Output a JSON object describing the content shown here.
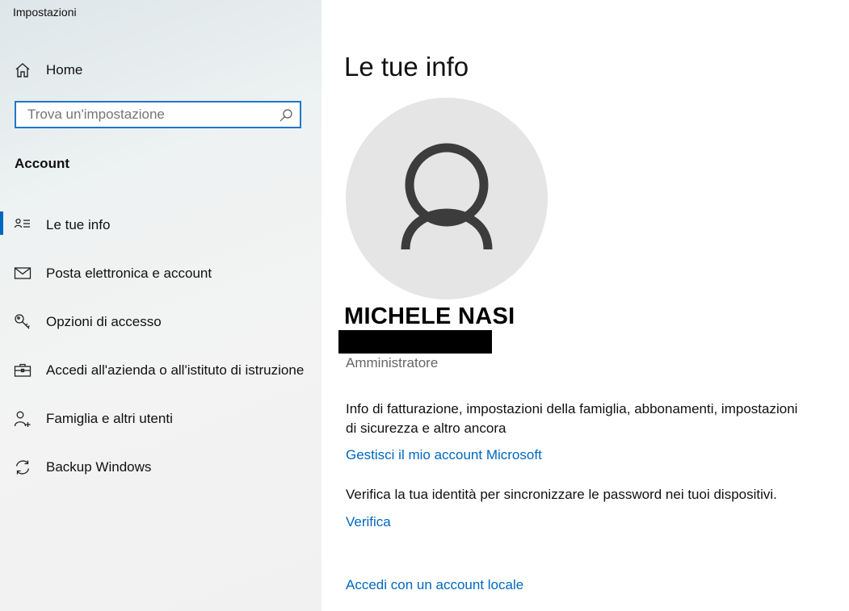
{
  "app": {
    "title": "Impostazioni"
  },
  "sidebar": {
    "home_label": "Home",
    "search": {
      "placeholder": "Trova un'impostazione",
      "value": ""
    },
    "section_title": "Account",
    "items": [
      {
        "label": "Le tue info",
        "icon": "user-card-icon",
        "active": true
      },
      {
        "label": "Posta elettronica e account",
        "icon": "mail-icon",
        "active": false
      },
      {
        "label": "Opzioni di accesso",
        "icon": "key-icon",
        "active": false
      },
      {
        "label": "Accedi all'azienda o all'istituto di istruzione",
        "icon": "briefcase-icon",
        "active": false
      },
      {
        "label": "Famiglia e altri utenti",
        "icon": "add-person-icon",
        "active": false
      },
      {
        "label": "Backup Windows",
        "icon": "sync-icon",
        "active": false
      }
    ]
  },
  "main": {
    "title": "Le tue info",
    "user": {
      "name": "MICHELE NASI",
      "role": "Amministratore"
    },
    "billing_info": "Info di fatturazione, impostazioni della famiglia, abbonamenti, impostazioni di sicurezza e altro ancora",
    "manage_link": "Gestisci il mio account Microsoft",
    "verify_text": "Verifica la tua identità per sincronizzare le password nei tuoi dispositivi.",
    "verify_link": "Verifica",
    "local_account_link": "Accedi con un account locale"
  },
  "colors": {
    "accent": "#0067c0",
    "search_border": "#1e78c8",
    "avatar_bg": "#e5e5e5"
  }
}
